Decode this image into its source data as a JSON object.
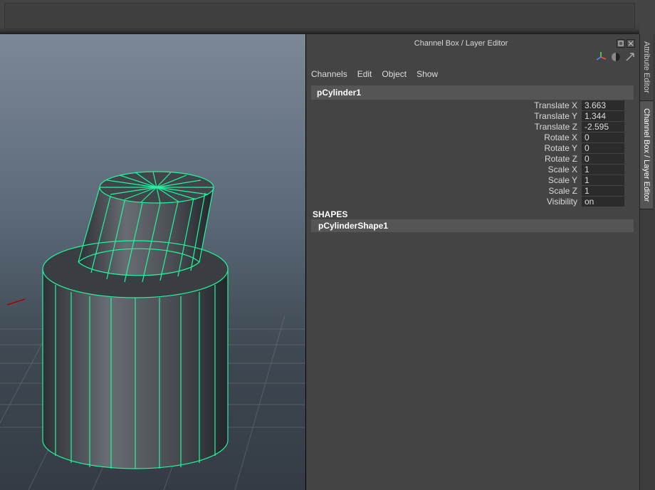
{
  "panel_title": "Channel Box / Layer Editor",
  "menu": {
    "channels": "Channels",
    "edit": "Edit",
    "object": "Object",
    "show": "Show"
  },
  "node_name": "pCylinder1",
  "channels": [
    {
      "label": "Translate X",
      "value": "3.663"
    },
    {
      "label": "Translate Y",
      "value": "1.344"
    },
    {
      "label": "Translate Z",
      "value": "-2.595"
    },
    {
      "label": "Rotate X",
      "value": "0"
    },
    {
      "label": "Rotate Y",
      "value": "0"
    },
    {
      "label": "Rotate Z",
      "value": "0"
    },
    {
      "label": "Scale X",
      "value": "1"
    },
    {
      "label": "Scale Y",
      "value": "1"
    },
    {
      "label": "Scale Z",
      "value": "1"
    },
    {
      "label": "Visibility",
      "value": "on"
    }
  ],
  "shapes_header": "SHAPES",
  "shape_name": "pCylinderShape1",
  "vtabs": {
    "attr": "Attribute Editor",
    "cb": "Channel Box / Layer Editor"
  },
  "chart_data": {
    "type": "table",
    "title": "Channel Box transform values for pCylinder1",
    "rows": [
      [
        "Translate X",
        3.663
      ],
      [
        "Translate Y",
        1.344
      ],
      [
        "Translate Z",
        -2.595
      ],
      [
        "Rotate X",
        0
      ],
      [
        "Rotate Y",
        0
      ],
      [
        "Rotate Z",
        0
      ],
      [
        "Scale X",
        1
      ],
      [
        "Scale Y",
        1
      ],
      [
        "Scale Z",
        1
      ],
      [
        "Visibility",
        "on"
      ]
    ]
  }
}
